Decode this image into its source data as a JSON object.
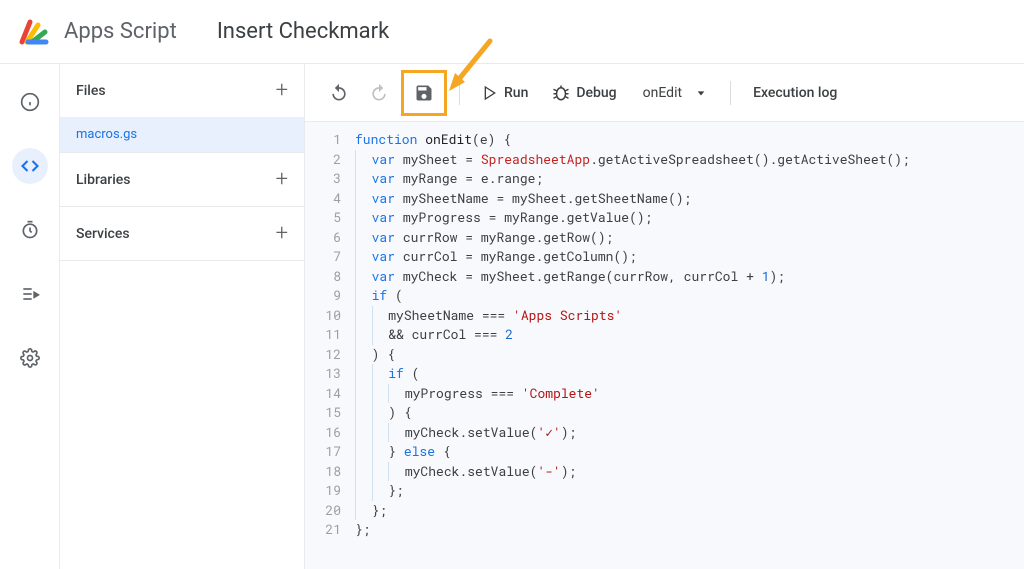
{
  "header": {
    "app_name": "Apps Script",
    "project_name": "Insert Checkmark"
  },
  "sidebar": {
    "files_label": "Files",
    "libraries_label": "Libraries",
    "services_label": "Services",
    "file_name": "macros.gs"
  },
  "toolbar": {
    "run_label": "Run",
    "debug_label": "Debug",
    "function_selected": "onEdit",
    "execution_log_label": "Execution log"
  },
  "code": {
    "lines": 21,
    "tokens": [
      [
        {
          "t": "function ",
          "c": "kw"
        },
        {
          "t": "onEdit",
          "c": "fn"
        },
        {
          "t": "(e) {",
          "c": ""
        }
      ],
      [
        {
          "t": "var ",
          "c": "kw"
        },
        {
          "t": "mySheet = ",
          "c": ""
        },
        {
          "t": "SpreadsheetApp",
          "c": "cls"
        },
        {
          "t": ".getActiveSpreadsheet().getActiveSheet();",
          "c": ""
        }
      ],
      [
        {
          "t": "var ",
          "c": "kw"
        },
        {
          "t": "myRange = e.range;",
          "c": ""
        }
      ],
      [
        {
          "t": "var ",
          "c": "kw"
        },
        {
          "t": "mySheetName = mySheet.getSheetName();",
          "c": ""
        }
      ],
      [
        {
          "t": "var ",
          "c": "kw"
        },
        {
          "t": "myProgress = myRange.getValue();",
          "c": ""
        }
      ],
      [
        {
          "t": "var ",
          "c": "kw"
        },
        {
          "t": "currRow = myRange.getRow();",
          "c": ""
        }
      ],
      [
        {
          "t": "var ",
          "c": "kw"
        },
        {
          "t": "currCol = myRange.getColumn();",
          "c": ""
        }
      ],
      [
        {
          "t": "var ",
          "c": "kw"
        },
        {
          "t": "myCheck = mySheet.getRange(currRow, currCol + ",
          "c": ""
        },
        {
          "t": "1",
          "c": "num"
        },
        {
          "t": ");",
          "c": ""
        }
      ],
      [
        {
          "t": "if ",
          "c": "kw"
        },
        {
          "t": "(",
          "c": ""
        }
      ],
      [
        {
          "t": "mySheetName === ",
          "c": ""
        },
        {
          "t": "'Apps Scripts'",
          "c": "str"
        }
      ],
      [
        {
          "t": "&& currCol === ",
          "c": ""
        },
        {
          "t": "2",
          "c": "num"
        }
      ],
      [
        {
          "t": ") {",
          "c": ""
        }
      ],
      [
        {
          "t": "if ",
          "c": "kw"
        },
        {
          "t": "(",
          "c": ""
        }
      ],
      [
        {
          "t": "myProgress === ",
          "c": ""
        },
        {
          "t": "'Complete'",
          "c": "str"
        }
      ],
      [
        {
          "t": ") {",
          "c": ""
        }
      ],
      [
        {
          "t": "myCheck.setValue(",
          "c": ""
        },
        {
          "t": "'✓'",
          "c": "str"
        },
        {
          "t": ");",
          "c": ""
        }
      ],
      [
        {
          "t": "} ",
          "c": ""
        },
        {
          "t": "else ",
          "c": "kw"
        },
        {
          "t": "{",
          "c": ""
        }
      ],
      [
        {
          "t": "myCheck.setValue(",
          "c": ""
        },
        {
          "t": "'-'",
          "c": "str"
        },
        {
          "t": ");",
          "c": ""
        }
      ],
      [
        {
          "t": "};",
          "c": ""
        }
      ],
      [
        {
          "t": "};",
          "c": ""
        }
      ],
      [
        {
          "t": "};",
          "c": ""
        }
      ]
    ],
    "indents": [
      0,
      1,
      1,
      1,
      1,
      1,
      1,
      1,
      1,
      2,
      2,
      1,
      2,
      3,
      2,
      3,
      2,
      3,
      2,
      1,
      0
    ]
  }
}
